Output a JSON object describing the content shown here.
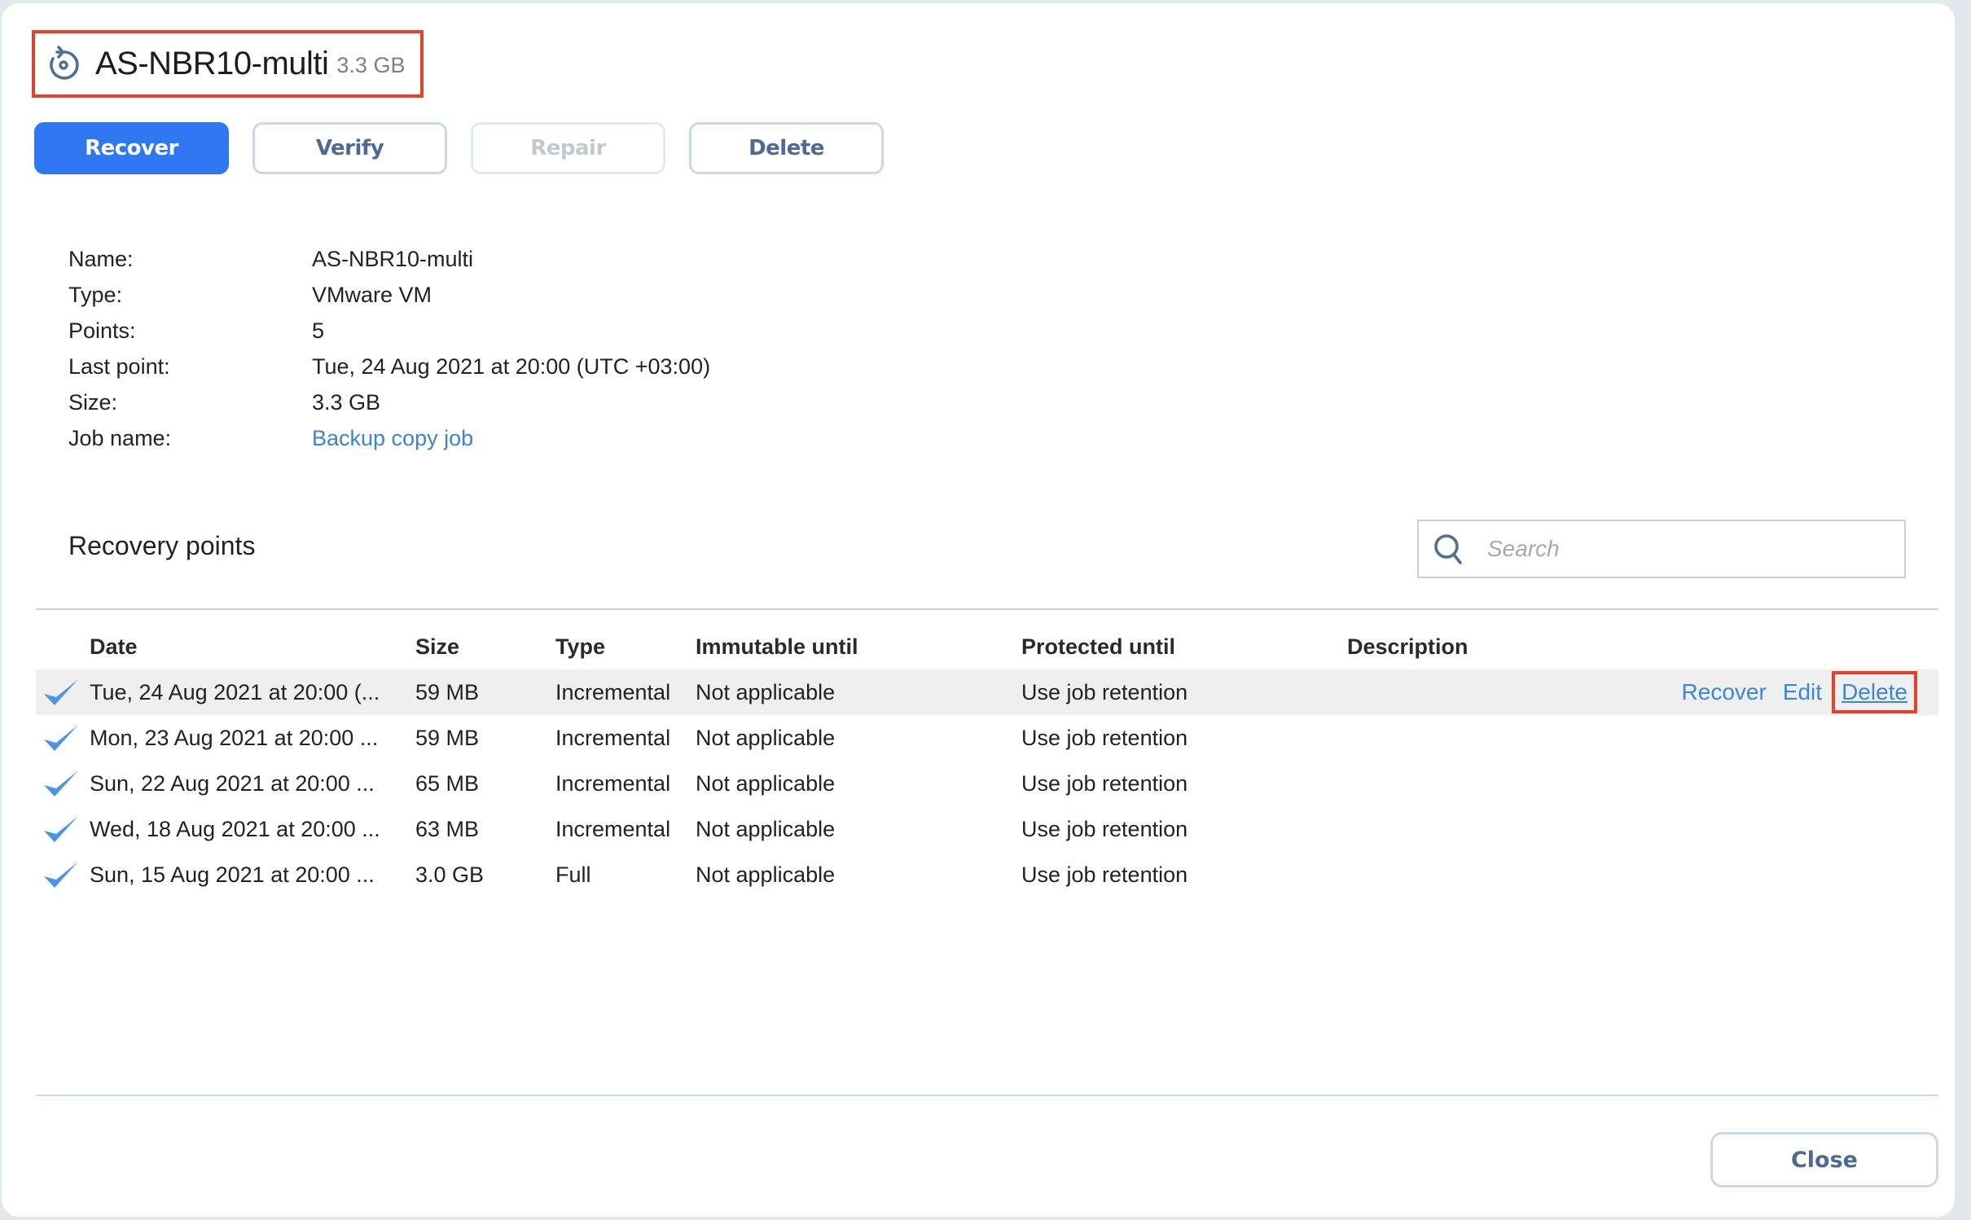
{
  "header": {
    "icon": "restore-disk-icon",
    "title": "AS-NBR10-multi",
    "size": "3.3 GB"
  },
  "toolbar": {
    "recover_label": "Recover",
    "verify_label": "Verify",
    "repair_label": "Repair",
    "delete_label": "Delete"
  },
  "details": [
    {
      "label": "Name:",
      "value": "AS-NBR10-multi"
    },
    {
      "label": "Type:",
      "value": "VMware VM"
    },
    {
      "label": "Points:",
      "value": "5"
    },
    {
      "label": "Last point:",
      "value": "Tue, 24 Aug 2021 at 20:00 (UTC +03:00)"
    },
    {
      "label": "Size:",
      "value": "3.3 GB"
    },
    {
      "label": "Job name:",
      "value": "Backup copy job"
    }
  ],
  "recovery_points": {
    "title": "Recovery points",
    "search_placeholder": "Search",
    "columns": [
      "Date",
      "Size",
      "Type",
      "Immutable until",
      "Protected until",
      "Description"
    ],
    "rows": [
      {
        "status": "check-icon",
        "date": "Tue, 24 Aug 2021 at 20:00 (...",
        "size": "59 MB",
        "type": "Incremental",
        "immutable": "Not applicable",
        "protected": "Use job retention",
        "description": ""
      },
      {
        "status": "check-icon",
        "date": "Mon, 23 Aug 2021 at 20:00 ...",
        "size": "59 MB",
        "type": "Incremental",
        "immutable": "Not applicable",
        "protected": "Use job retention",
        "description": ""
      },
      {
        "status": "check-icon",
        "date": "Sun, 22 Aug 2021 at 20:00 ...",
        "size": "65 MB",
        "type": "Incremental",
        "immutable": "Not applicable",
        "protected": "Use job retention",
        "description": ""
      },
      {
        "status": "check-icon",
        "date": "Wed, 18 Aug 2021 at 20:00 ...",
        "size": "63 MB",
        "type": "Incremental",
        "immutable": "Not applicable",
        "protected": "Use job retention",
        "description": ""
      },
      {
        "status": "check-icon",
        "date": "Sun, 15 Aug 2021 at 20:00 ...",
        "size": "3.0 GB",
        "type": "Full",
        "immutable": "Not applicable",
        "protected": "Use job retention",
        "description": ""
      }
    ],
    "row_actions": {
      "recover": "Recover",
      "edit": "Edit",
      "delete": "Delete"
    }
  },
  "footer": {
    "close_label": "Close"
  },
  "colors": {
    "primary": "#2f77f0",
    "link": "#3a86dc",
    "highlight": "#e5412d",
    "check": "#4a95e8"
  }
}
